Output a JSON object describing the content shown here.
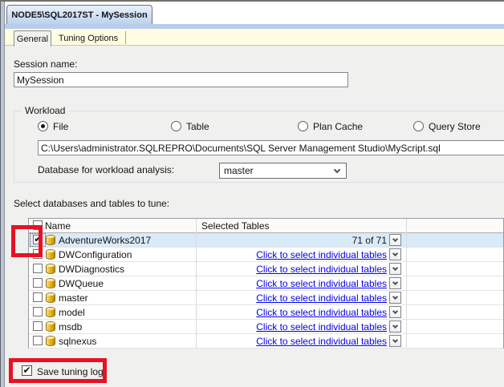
{
  "window": {
    "tab_title": "NODE5\\SQL2017ST - MySession"
  },
  "tabs": [
    {
      "label": "General",
      "selected": true
    },
    {
      "label": "Tuning Options",
      "selected": false
    }
  ],
  "session": {
    "label": "Session name:",
    "value": "MySession"
  },
  "workload": {
    "legend": "Workload",
    "options": [
      {
        "label": "File",
        "selected": true
      },
      {
        "label": "Table",
        "selected": false
      },
      {
        "label": "Plan Cache",
        "selected": false
      },
      {
        "label": "Query Store",
        "selected": false
      }
    ],
    "file_path": "C:\\Users\\administrator.SQLREPRO\\Documents\\SQL Server Management Studio\\MyScript.sql"
  },
  "analysis": {
    "label": "Database for workload analysis:",
    "selected_database": "master"
  },
  "tune": {
    "label": "Select databases and tables to tune:"
  },
  "grid": {
    "columns": [
      "Name",
      "Selected Tables"
    ],
    "rows": [
      {
        "name": "AdventureWorks2017",
        "checked": true,
        "row_selected": true,
        "selected_tables": "71 of 71",
        "is_link": false
      },
      {
        "name": "DWConfiguration",
        "checked": false,
        "row_selected": false,
        "selected_tables": "Click to select individual tables",
        "is_link": true
      },
      {
        "name": "DWDiagnostics",
        "checked": false,
        "row_selected": false,
        "selected_tables": "Click to select individual tables",
        "is_link": true
      },
      {
        "name": "DWQueue",
        "checked": false,
        "row_selected": false,
        "selected_tables": "Click to select individual tables",
        "is_link": true
      },
      {
        "name": "master",
        "checked": false,
        "row_selected": false,
        "selected_tables": "Click to select individual tables",
        "is_link": true
      },
      {
        "name": "model",
        "checked": false,
        "row_selected": false,
        "selected_tables": "Click to select individual tables",
        "is_link": true
      },
      {
        "name": "msdb",
        "checked": false,
        "row_selected": false,
        "selected_tables": "Click to select individual tables",
        "is_link": true
      },
      {
        "name": "sqlnexus",
        "checked": false,
        "row_selected": false,
        "selected_tables": "Click to select individual tables",
        "is_link": true
      }
    ]
  },
  "footer": {
    "save_tuning_log_label": "Save tuning log",
    "checked": true
  },
  "icons": {
    "check": "✔",
    "database_icon": "database-cylinder",
    "dropdown_icon": "chevron-down"
  },
  "colors": {
    "annotation_red": "#e81123",
    "link_blue": "#0000ee",
    "row_selection_blue": "#d9eaf8",
    "doc_tab_gradient_top": "#e8f1fc",
    "doc_tab_gradient_bottom": "#bdd2ee",
    "tab_strip_yellow": "#fffce1"
  }
}
